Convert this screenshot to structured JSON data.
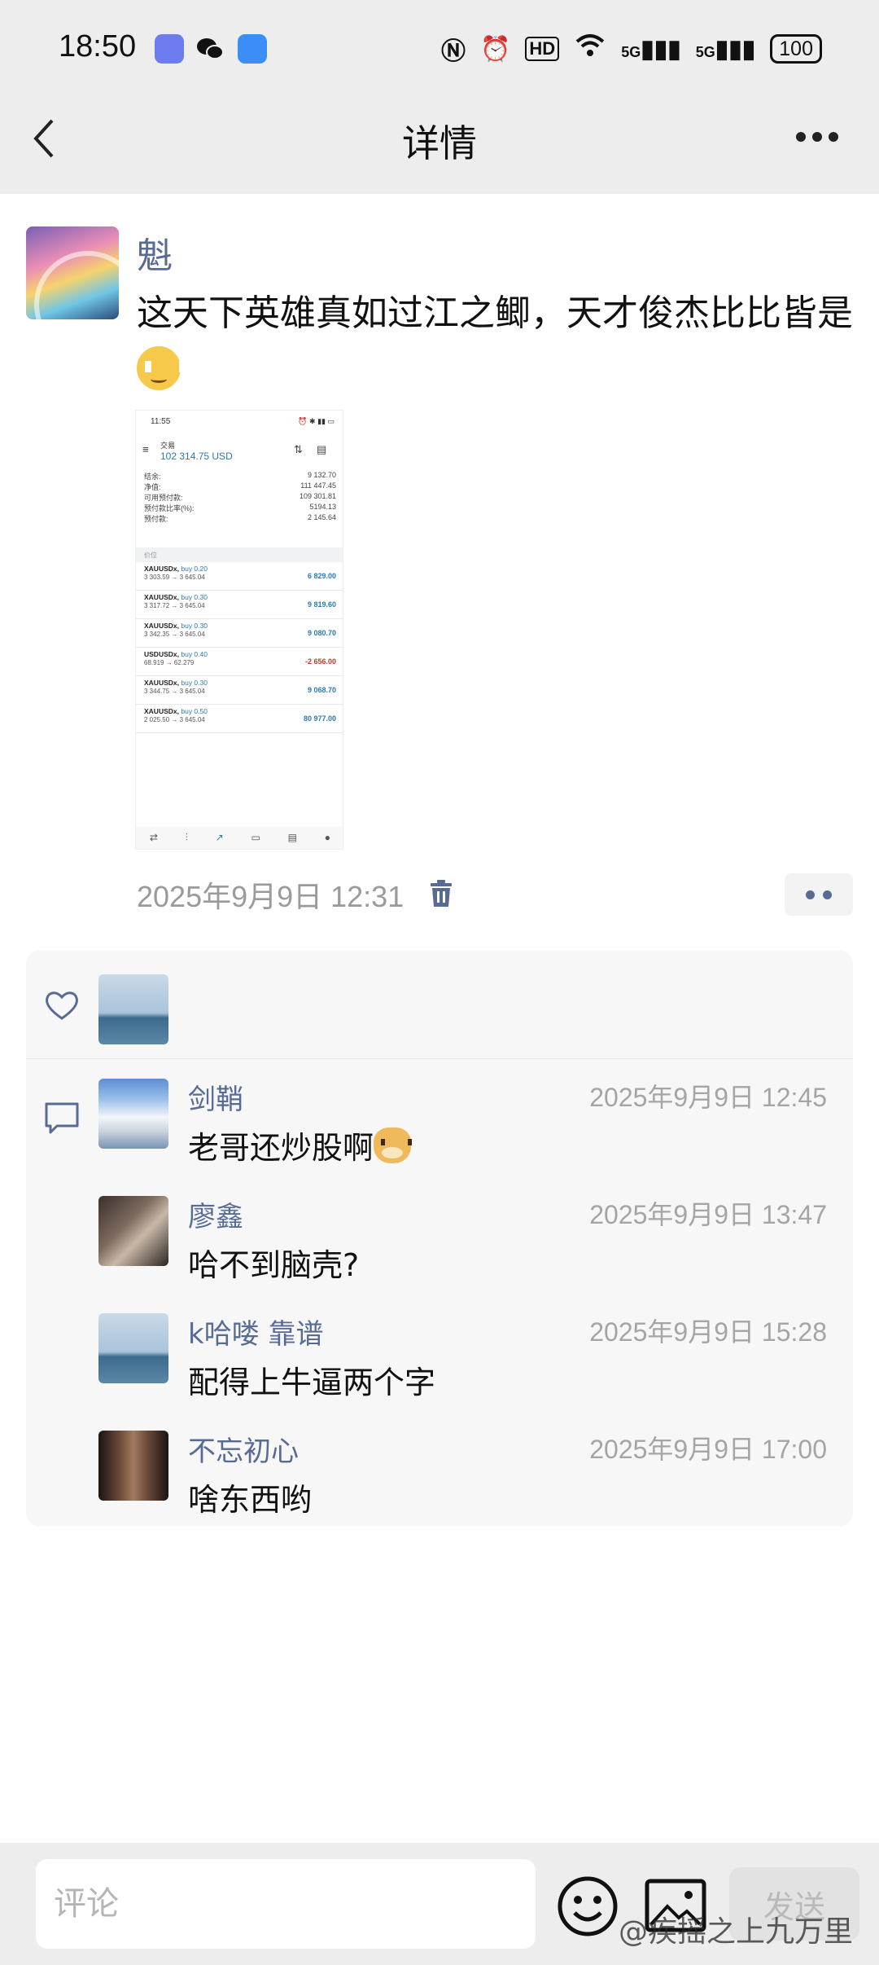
{
  "status_bar": {
    "time": "18:50",
    "network": "5G",
    "battery": "100"
  },
  "nav": {
    "title": "详情"
  },
  "post": {
    "author": "魁",
    "text": "这天下英雄真如过江之鲫，天才俊杰比比皆是",
    "time": "2025年9月9日 12:31",
    "screenshot": {
      "time": "11:55",
      "account_label": "交易",
      "balance": "102 314.75 USD",
      "summary": [
        {
          "label": "结余:",
          "value": "9 132.70"
        },
        {
          "label": "净值:",
          "value": "111 447.45"
        },
        {
          "label": "可用预付款:",
          "value": "109 301.81"
        },
        {
          "label": "预付款比率(%):",
          "value": "5194.13"
        },
        {
          "label": "预付款:",
          "value": "2 145.64"
        }
      ],
      "section": "价位",
      "trades": [
        {
          "symbol": "XAUUSDx,",
          "dir": "buy 0.20",
          "prices": "3 303.59 → 3 645.04",
          "profit": "6 829.00",
          "color": "#2a7ab0"
        },
        {
          "symbol": "XAUUSDx,",
          "dir": "buy 0.30",
          "prices": "3 317.72 → 3 645.04",
          "profit": "9 819.60",
          "color": "#2a7ab0"
        },
        {
          "symbol": "XAUUSDx,",
          "dir": "buy 0.30",
          "prices": "3 342.35 → 3 645.04",
          "profit": "9 080.70",
          "color": "#2a7ab0"
        },
        {
          "symbol": "USDUSDx,",
          "dir": "buy 0.40",
          "prices": "68.919 → 62.279",
          "profit": "-2 656.00",
          "color": "#c0392b"
        },
        {
          "symbol": "XAUUSDx,",
          "dir": "buy 0.30",
          "prices": "3 344.75 → 3 645.04",
          "profit": "9 068.70",
          "color": "#2a7ab0"
        },
        {
          "symbol": "XAUUSDx,",
          "dir": "buy 0.50",
          "prices": "2 025.50 → 3 645.04",
          "profit": "80 977.00",
          "color": "#2a7ab0"
        }
      ]
    }
  },
  "comments": [
    {
      "name": "剑鞘",
      "time": "2025年9月9日 12:45",
      "text": "老哥还炒股啊",
      "has_emoji": true
    },
    {
      "name": "廖鑫",
      "time": "2025年9月9日 13:47",
      "text": "哈不到脑壳?"
    },
    {
      "name": "k哈喽 靠谱",
      "time": "2025年9月9日 15:28",
      "text": "配得上牛逼两个字"
    },
    {
      "name": "不忘初心",
      "time": "2025年9月9日 17:00",
      "text": "啥东西哟"
    }
  ],
  "bottom": {
    "placeholder": "评论",
    "send": "发送",
    "watermark": "@疾摇之上九万里"
  },
  "colors": {
    "link": "#576b95",
    "time": "#a5a5a5",
    "panel": "#f7f7f7"
  }
}
